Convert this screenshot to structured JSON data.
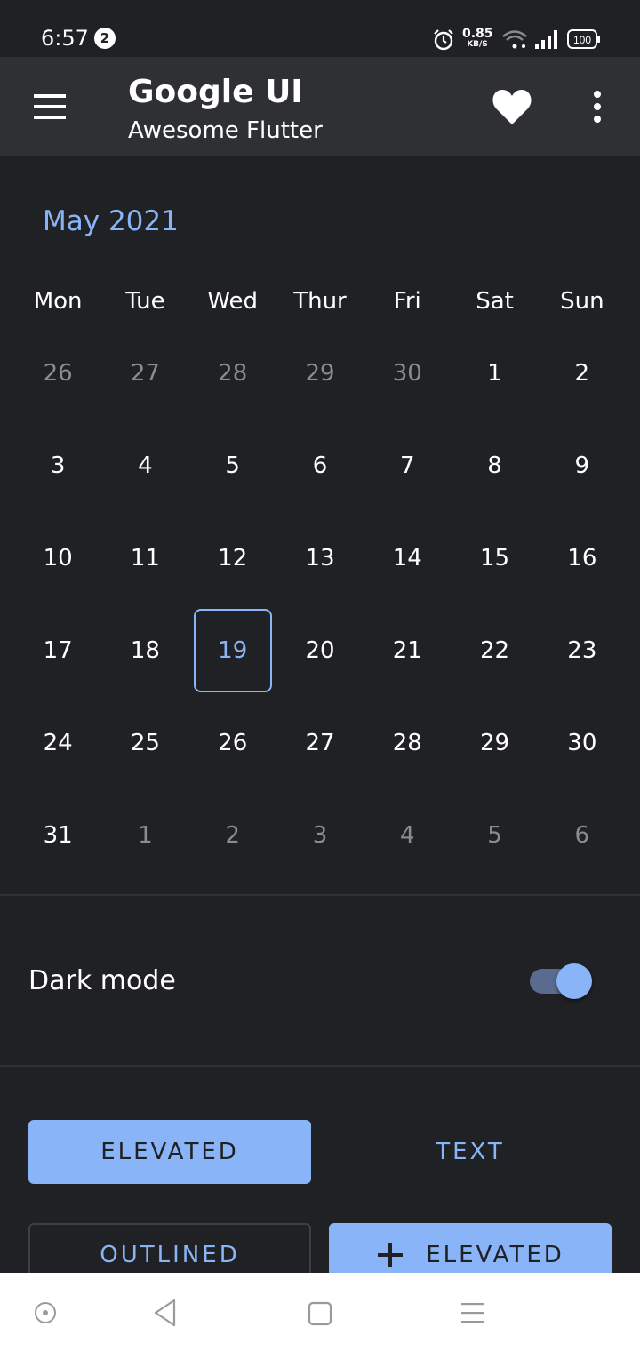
{
  "status_bar": {
    "time": "6:57",
    "notification_count": "2",
    "net_speed_value": "0.85",
    "net_speed_unit": "KB/S",
    "battery": "100",
    "icons": [
      "alarm-icon",
      "wifi-icon",
      "signal-icon",
      "battery-icon"
    ]
  },
  "app_bar": {
    "title": "Google UI",
    "subtitle": "Awesome Flutter",
    "icons": [
      "menu-icon",
      "heart-icon",
      "more-vert-icon"
    ]
  },
  "calendar": {
    "month_label": "May 2021",
    "weekdays": [
      "Mon",
      "Tue",
      "Wed",
      "Thur",
      "Fri",
      "Sat",
      "Sun"
    ],
    "weeks": [
      [
        {
          "d": "26",
          "m": true
        },
        {
          "d": "27",
          "m": true
        },
        {
          "d": "28",
          "m": true
        },
        {
          "d": "29",
          "m": true
        },
        {
          "d": "30",
          "m": true
        },
        {
          "d": "1",
          "m": false
        },
        {
          "d": "2",
          "m": false
        }
      ],
      [
        {
          "d": "3",
          "m": false
        },
        {
          "d": "4",
          "m": false
        },
        {
          "d": "5",
          "m": false
        },
        {
          "d": "6",
          "m": false
        },
        {
          "d": "7",
          "m": false
        },
        {
          "d": "8",
          "m": false
        },
        {
          "d": "9",
          "m": false
        }
      ],
      [
        {
          "d": "10",
          "m": false
        },
        {
          "d": "11",
          "m": false
        },
        {
          "d": "12",
          "m": false
        },
        {
          "d": "13",
          "m": false
        },
        {
          "d": "14",
          "m": false
        },
        {
          "d": "15",
          "m": false
        },
        {
          "d": "16",
          "m": false
        }
      ],
      [
        {
          "d": "17",
          "m": false
        },
        {
          "d": "18",
          "m": false
        },
        {
          "d": "19",
          "m": false
        },
        {
          "d": "20",
          "m": false
        },
        {
          "d": "21",
          "m": false
        },
        {
          "d": "22",
          "m": false
        },
        {
          "d": "23",
          "m": false
        }
      ],
      [
        {
          "d": "24",
          "m": false
        },
        {
          "d": "25",
          "m": false
        },
        {
          "d": "26",
          "m": false
        },
        {
          "d": "27",
          "m": false
        },
        {
          "d": "28",
          "m": false
        },
        {
          "d": "29",
          "m": false
        },
        {
          "d": "30",
          "m": false
        }
      ],
      [
        {
          "d": "31",
          "m": false
        },
        {
          "d": "1",
          "m": true
        },
        {
          "d": "2",
          "m": true
        },
        {
          "d": "3",
          "m": true
        },
        {
          "d": "4",
          "m": true
        },
        {
          "d": "5",
          "m": true
        },
        {
          "d": "6",
          "m": true
        }
      ]
    ],
    "selected_day": "19"
  },
  "settings": {
    "dark_mode_label": "Dark mode",
    "dark_mode_on": true
  },
  "buttons": {
    "elevated": "ELEVATED",
    "text": "TEXT",
    "outlined": "OUTLINED",
    "elevated_icon": "ELEVATED"
  },
  "nav_bar": {
    "icons": [
      "assistant-icon",
      "back-icon",
      "home-icon",
      "recents-icon"
    ]
  },
  "colors": {
    "background": "#202124",
    "app_bar": "#2e3034",
    "accent": "#8ab4f8",
    "muted_text": "#8a8c90"
  }
}
